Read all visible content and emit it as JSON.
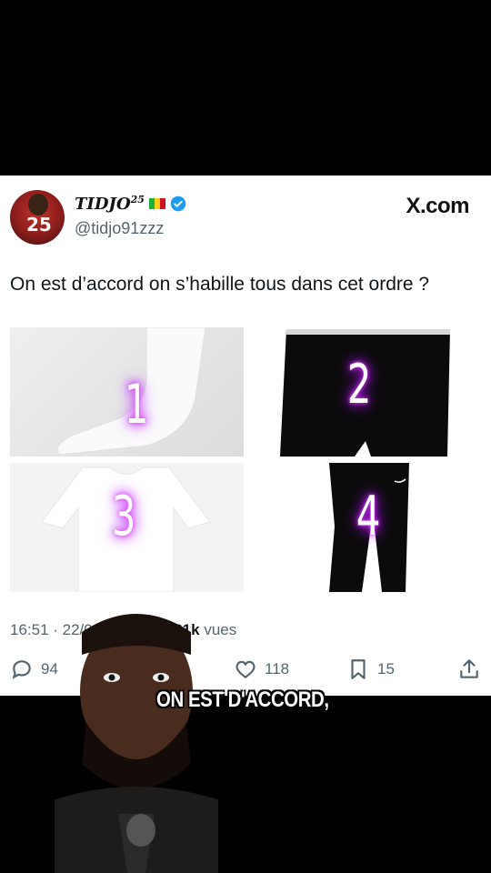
{
  "tweet": {
    "display_name": "TIDJO",
    "name_sup": "25",
    "handle": "@tidjo91zzz",
    "brand": "X.com",
    "avatar_number": "25",
    "text": "On est d’accord on s’habille tous dans cet ordre ?",
    "images": [
      {
        "label": "1",
        "item": "sock"
      },
      {
        "label": "2",
        "item": "boxer"
      },
      {
        "label": "3",
        "item": "t-shirt"
      },
      {
        "label": "4",
        "item": "pants"
      }
    ],
    "time": "16:51 · 22/0",
    "views_count": "31k",
    "views_label": " vues",
    "replies": "94",
    "likes": "118",
    "bookmarks": "15"
  },
  "overlay": {
    "caption": "ON EST D'ACCORD,"
  },
  "colors": {
    "neon": "#e040fb",
    "verified": "#1d9bf0",
    "secondary_text": "#536471"
  }
}
